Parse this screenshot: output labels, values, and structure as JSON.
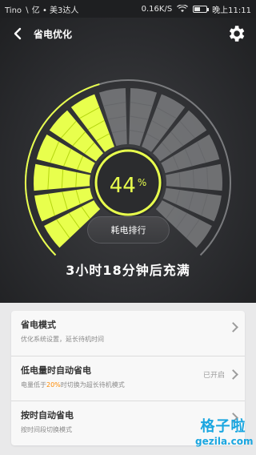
{
  "statusbar": {
    "carrier": "Tino ∖ 亿 • 美3达人",
    "speed": "0.16K/S",
    "time": "晚上11:11",
    "icons": [
      "signal-icon",
      "wifi-icon",
      "battery-icon"
    ]
  },
  "header": {
    "title": "省电优化",
    "back_icon": "back-arrow-icon",
    "settings_icon": "gear-icon"
  },
  "gauge": {
    "percent_value": "44",
    "percent_sign": "%",
    "filled_fraction": 0.44,
    "accent": "#e8ff4d",
    "accent_dark": "#b4d60f",
    "inactive": "#7a7b7e"
  },
  "rank_button": {
    "label": "耗电排行"
  },
  "remaining_text": "3小时18分钟后充满",
  "settings": {
    "items": [
      {
        "title": "省电模式",
        "subtitle": "优化系统设置，延长待机时间",
        "value": ""
      },
      {
        "title": "低电量时自动省电",
        "subtitle_prefix": "电量低于",
        "subtitle_highlight": "20%",
        "subtitle_suffix": "时切换为超长待机模式",
        "value": "已开启"
      },
      {
        "title": "按时自动省电",
        "subtitle": "按时间段切换模式",
        "value": ""
      }
    ]
  },
  "watermark": {
    "line1": "格子啦",
    "line2": "gezila.com"
  }
}
